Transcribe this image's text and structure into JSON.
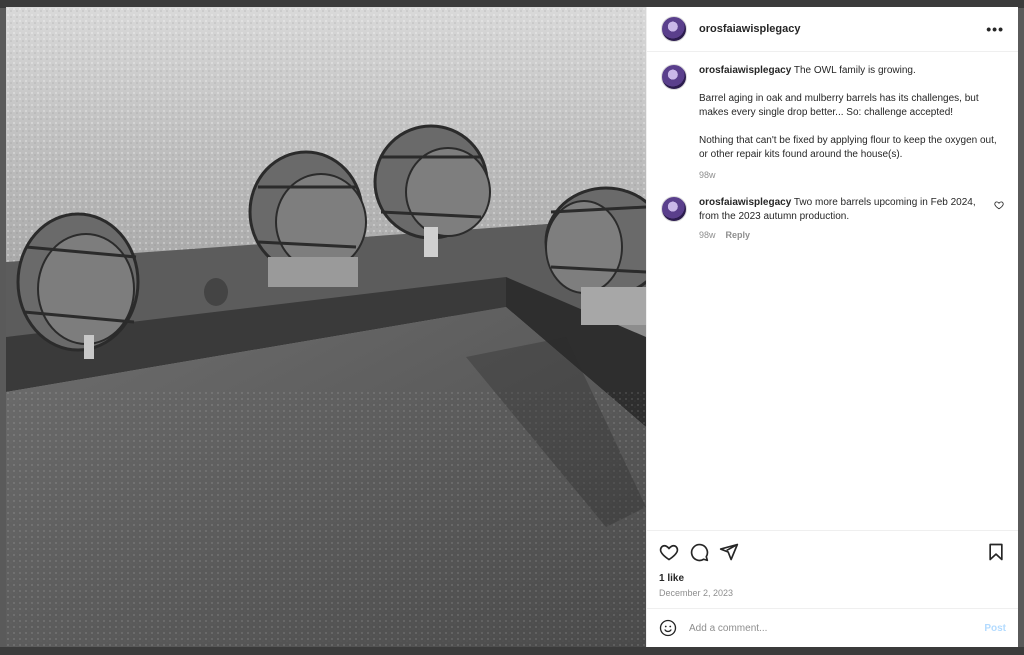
{
  "post": {
    "username": "orosfaiawisplegacy",
    "photo_alt": "",
    "caption": {
      "username": "orosfaiawisplegacy",
      "line1": "The OWL family is growing.",
      "paragraph2": "Barrel aging in oak and mulberry barrels has its challenges, but makes every single drop better... So: challenge accepted!",
      "paragraph3": "Nothing that can't be fixed by applying flour to keep the oxygen out, or other repair kits found around the house(s).",
      "age": "98w"
    },
    "comments": [
      {
        "username": "orosfaiawisplegacy",
        "text": "Two more barrels upcoming in Feb 2024, from the 2023 autumn production.",
        "age": "98w",
        "reply_label": "Reply"
      }
    ],
    "likes": "1 like",
    "date": "December 2, 2023"
  },
  "comment_input": {
    "placeholder": "Add a comment..."
  },
  "post_button": "Post",
  "more_label": "•••",
  "icons": [
    "more-options-icon",
    "heart-icon",
    "comment-icon",
    "share-icon",
    "bookmark-icon",
    "emoji-icon",
    "small-heart-icon"
  ]
}
